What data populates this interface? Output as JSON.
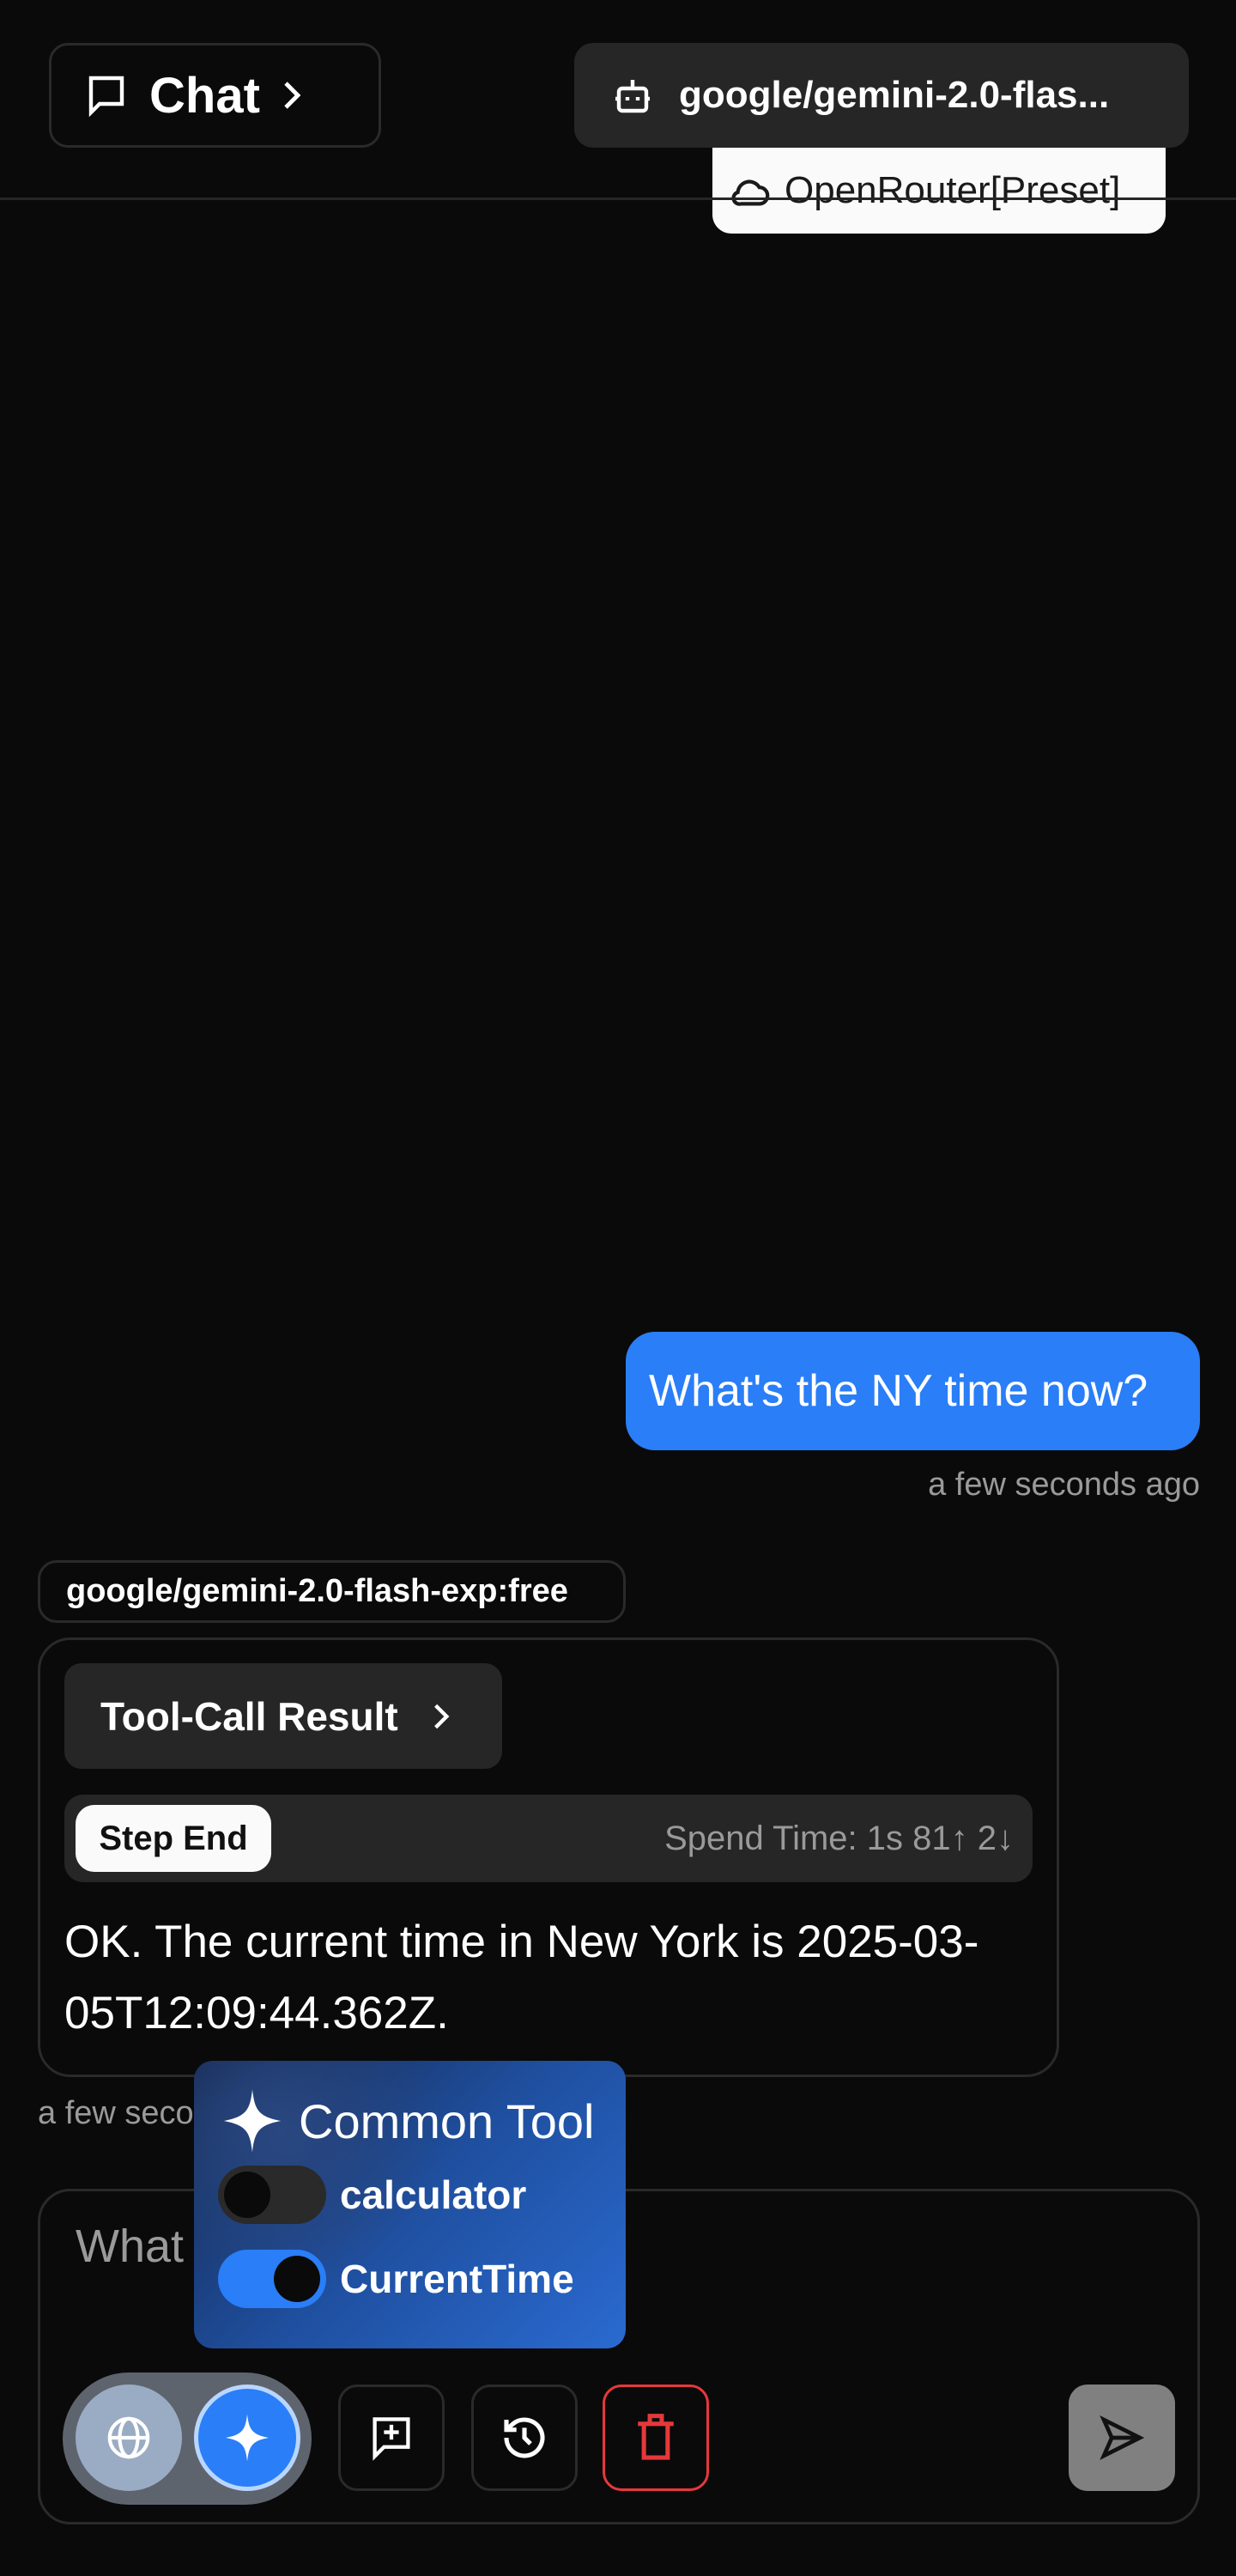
{
  "header": {
    "chat_label": "Chat",
    "model_label": "google/gemini-2.0-flas...",
    "provider_label": "OpenRouter[Preset]"
  },
  "messages": {
    "user": {
      "text": "What's the NY time now?",
      "time": "a few seconds ago"
    },
    "assistant": {
      "model": "google/gemini-2.0-flash-exp:free",
      "tool_call_label": "Tool-Call Result",
      "step_label": "Step End",
      "spend_time": "Spend Time: 1s 81↑ 2↓",
      "text": "OK. The current time in New York is 2025-03-05T12:09:44.362Z.",
      "time": "a few seconds ago"
    }
  },
  "input": {
    "placeholder": "What"
  },
  "tools_popup": {
    "title": "Common Tool",
    "tools": [
      {
        "name": "calculator",
        "enabled": false
      },
      {
        "name": "CurrentTime",
        "enabled": true
      }
    ]
  },
  "colors": {
    "accent": "#2a7ef7",
    "danger": "#e5383b",
    "background": "#0a0a0a"
  }
}
